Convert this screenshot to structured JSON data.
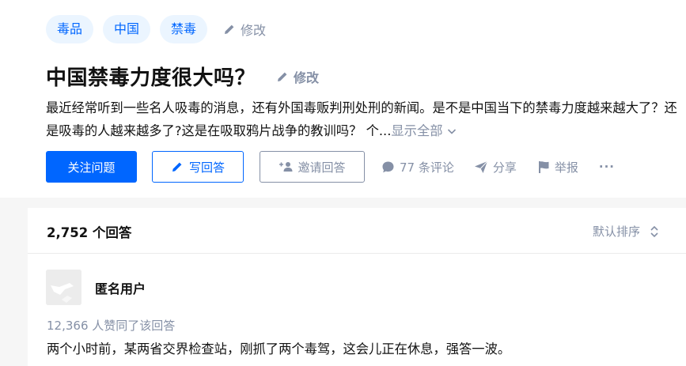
{
  "question": {
    "topics": [
      "毒品",
      "中国",
      "禁毒"
    ],
    "edit_topics_label": "修改",
    "title": "中国禁毒力度很大吗？",
    "edit_title_label": "修改",
    "detail": "最近经常听到一些名人吸毒的消息，还有外国毒贩判刑处刑的新闻。是不是中国当下的禁毒力度越来越大了？还是吸毒的人越来越多了?这是在吸取鸦片战争的教训吗？ 个...",
    "show_all_label": "显示全部"
  },
  "actions": {
    "follow_label": "关注问题",
    "write_label": "写回答",
    "invite_label": "邀请回答",
    "comments_label": "77 条评论",
    "share_label": "分享",
    "report_label": "举报",
    "more_label": "···"
  },
  "answers": {
    "count_label": "2,752 个回答",
    "sort_label": "默认排序",
    "first": {
      "author": "匿名用户",
      "votes_label": "12,366 人赞同了该回答",
      "excerpt": "两个小时前，某两省交界检查站，刚抓了两个毒驾，这会儿正在休息，强答一波。"
    }
  },
  "colors": {
    "brand": "#0066ff",
    "topic_bg": "#ebf5ff",
    "muted": "#8590a6",
    "page_bg": "#f6f6f6"
  },
  "icons": {
    "edit": "pencil-icon",
    "show_all": "chevron-down-icon",
    "invite": "add-user-icon",
    "comment": "comment-bubble-icon",
    "share": "paper-plane-icon",
    "report": "flag-icon",
    "sort": "sort-arrows-icon"
  }
}
